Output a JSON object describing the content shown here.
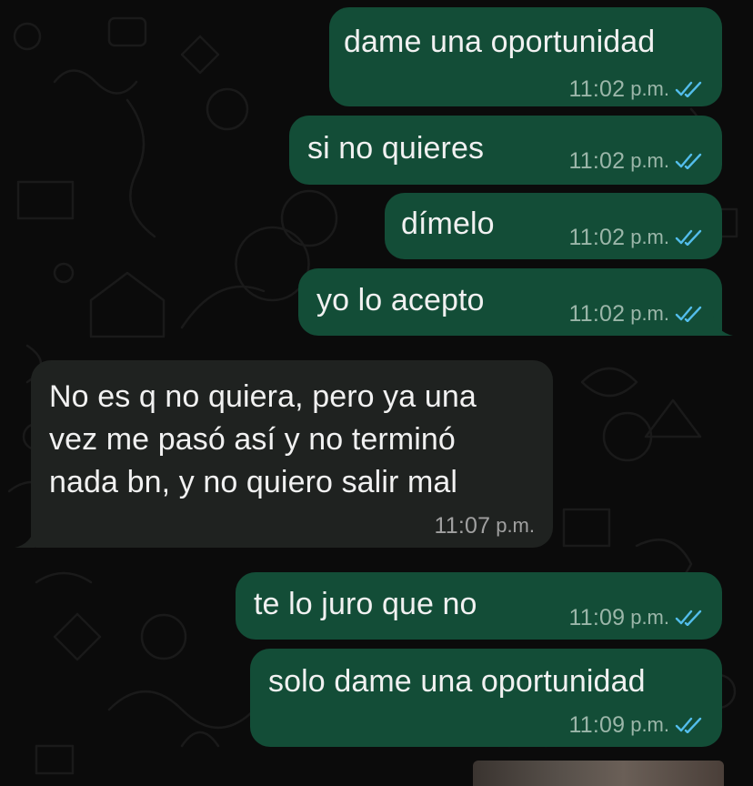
{
  "chat": {
    "messages": [
      {
        "id": "m1",
        "direction": "outgoing",
        "text": "dame una oportunidad",
        "time": "11:02",
        "ampm": "p.m.",
        "status": "read"
      },
      {
        "id": "m2",
        "direction": "outgoing",
        "text": "si no quieres",
        "time": "11:02",
        "ampm": "p.m.",
        "status": "read"
      },
      {
        "id": "m3",
        "direction": "outgoing",
        "text": "dímelo",
        "time": "11:02",
        "ampm": "p.m.",
        "status": "read"
      },
      {
        "id": "m4",
        "direction": "outgoing",
        "text": "yo lo acepto",
        "time": "11:02",
        "ampm": "p.m.",
        "status": "read"
      },
      {
        "id": "m5",
        "direction": "incoming",
        "lines": [
          "No es q no quiera, pero ya una",
          "vez me pasó así y no terminó",
          "nada bn, y no quiero salir mal"
        ],
        "time": "11:07",
        "ampm": "p.m."
      },
      {
        "id": "m6",
        "direction": "outgoing",
        "text": "te lo juro que no",
        "time": "11:09",
        "ampm": "p.m.",
        "status": "read"
      },
      {
        "id": "m7",
        "direction": "outgoing",
        "text": "solo dame una oportunidad",
        "time": "11:09",
        "ampm": "p.m.",
        "status": "read"
      }
    ]
  },
  "colors": {
    "background": "#0b0b0b",
    "outgoing_bubble": "#134d37",
    "incoming_bubble": "#1f2220",
    "read_ticks": "#53bdeb",
    "text": "#f1f1f1"
  },
  "icons": {
    "read_receipt": "double-check-icon"
  }
}
